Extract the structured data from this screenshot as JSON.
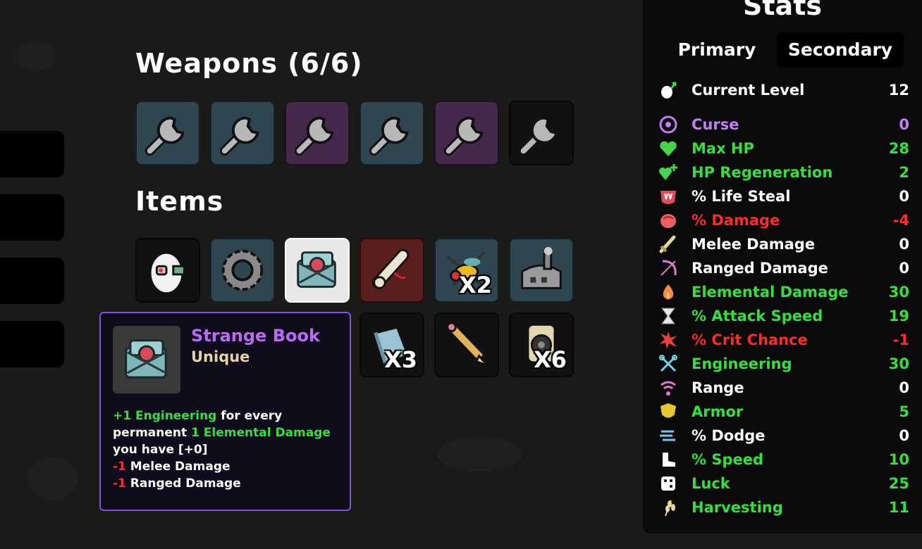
{
  "weapons": {
    "title": "Weapons (6/6)",
    "slots": [
      {
        "rarity": "common",
        "icon": "wrench-icon"
      },
      {
        "rarity": "common",
        "icon": "wrench-icon"
      },
      {
        "rarity": "epic",
        "icon": "wrench-icon"
      },
      {
        "rarity": "common",
        "icon": "wrench-icon"
      },
      {
        "rarity": "epic",
        "icon": "wrench-icon"
      },
      {
        "rarity": "base",
        "icon": "wrench-icon"
      }
    ]
  },
  "items": {
    "title": "Items",
    "row1": [
      {
        "icon": "egg-robot-icon",
        "rarity": "unique",
        "count": ""
      },
      {
        "icon": "gear-icon",
        "rarity": "rare",
        "count": ""
      },
      {
        "icon": "strange-book-icon",
        "rarity": "selected",
        "count": ""
      },
      {
        "icon": "scroll-icon",
        "rarity": "legend",
        "count": ""
      },
      {
        "icon": "wasp-icon",
        "rarity": "rare",
        "count": "X2"
      },
      {
        "icon": "factory-icon",
        "rarity": "rare",
        "count": ""
      }
    ],
    "row2": [
      {
        "icon": "book-icon",
        "rarity": "unique",
        "count": "X3"
      },
      {
        "icon": "pencil-icon",
        "rarity": "unique",
        "count": ""
      },
      {
        "icon": "speaker-icon",
        "rarity": "unique",
        "count": "X6"
      }
    ]
  },
  "tooltip": {
    "name": "Strange Book",
    "rarity": "Unique",
    "line1_value": "+1 Engineering",
    "line1_rest": " for every",
    "line2_start": "permanent ",
    "line2_value": "1 Elemental Damage",
    "line3": "you have [+0]",
    "line4_value": "-1",
    "line4_rest": " Melee Damage",
    "line5_value": "-1",
    "line5_rest": " Ranged Damage"
  },
  "stats": {
    "title": "Stats",
    "tab_primary": "Primary",
    "tab_secondary": "Secondary",
    "level": {
      "label": "Current Level",
      "value": "12",
      "icon": "level-up-icon"
    },
    "rows": [
      {
        "label": "Curse",
        "value": "0",
        "color": "#c57cf5",
        "icon": "curse-eye-icon"
      },
      {
        "label": "Max HP",
        "value": "28",
        "color": "#34e03d",
        "icon": "heart-icon"
      },
      {
        "label": "HP Regeneration",
        "value": "2",
        "color": "#34e03d",
        "icon": "heart-plus-icon"
      },
      {
        "label": "% Life Steal",
        "value": "0",
        "color": "#ffffff",
        "icon": "fangs-icon"
      },
      {
        "label": "% Damage",
        "value": "-4",
        "color": "#ff2b2b",
        "icon": "muscle-icon"
      },
      {
        "label": "Melee Damage",
        "value": "0",
        "color": "#ffffff",
        "icon": "sword-icon"
      },
      {
        "label": "Ranged Damage",
        "value": "0",
        "color": "#ffffff",
        "icon": "bow-icon"
      },
      {
        "label": "Elemental Damage",
        "value": "30",
        "color": "#34e03d",
        "icon": "flame-icon"
      },
      {
        "label": "% Attack Speed",
        "value": "19",
        "color": "#34e03d",
        "icon": "hourglass-icon"
      },
      {
        "label": "% Crit Chance",
        "value": "-1",
        "color": "#ff2b2b",
        "icon": "crit-star-icon"
      },
      {
        "label": "Engineering",
        "value": "30",
        "color": "#34e03d",
        "icon": "crossed-wrenches-icon"
      },
      {
        "label": "Range",
        "value": "0",
        "color": "#ffffff",
        "icon": "range-signal-icon"
      },
      {
        "label": "Armor",
        "value": "5",
        "color": "#34e03d",
        "icon": "shield-icon"
      },
      {
        "label": "% Dodge",
        "value": "0",
        "color": "#ffffff",
        "icon": "dodge-wind-icon"
      },
      {
        "label": "% Speed",
        "value": "10",
        "color": "#34e03d",
        "icon": "boot-icon"
      },
      {
        "label": "Luck",
        "value": "25",
        "color": "#34e03d",
        "icon": "dice-icon"
      },
      {
        "label": "Harvesting",
        "value": "11",
        "color": "#34e03d",
        "icon": "wheat-icon"
      }
    ]
  }
}
